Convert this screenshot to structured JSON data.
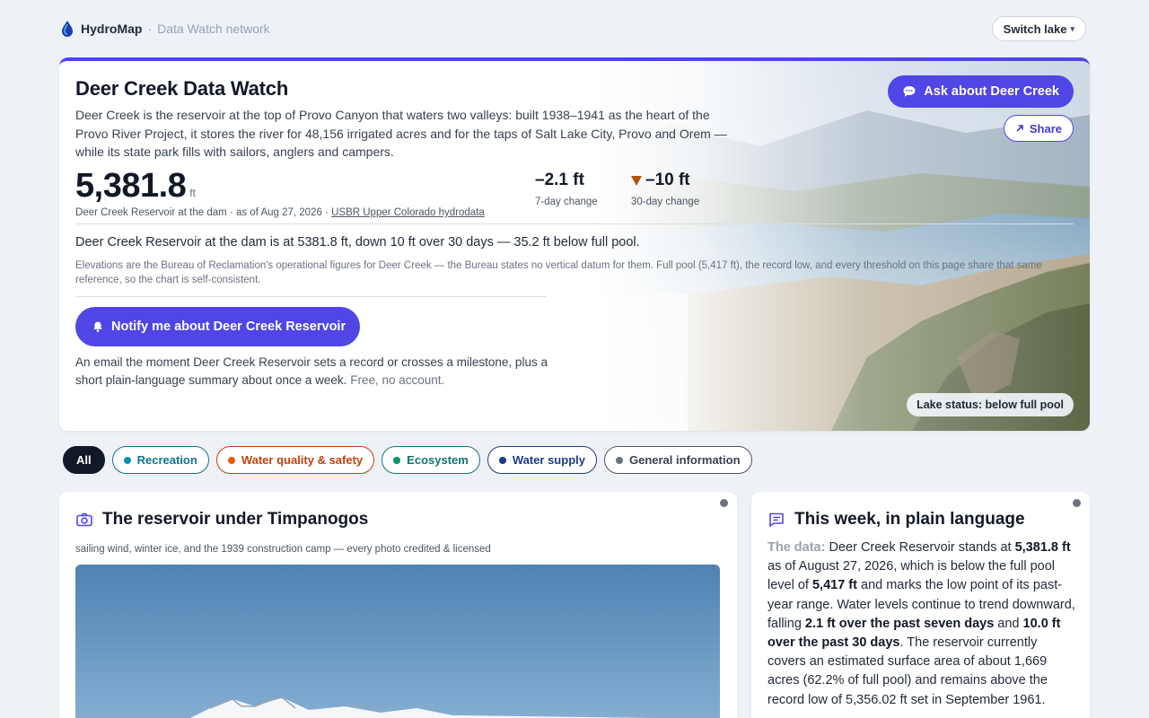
{
  "nav": {
    "brand": "HydroMap",
    "separator": "·",
    "subtitle": "Data Watch network",
    "switch_label": "Switch lake",
    "switch_caret": "▾"
  },
  "hero": {
    "title": "Deer Creek Data Watch",
    "intro": "Deer Creek is the reservoir at the top of Provo Canyon that waters two valleys: built 1938–1941 as the heart of the Provo River Project, it stores the river for 48,156 irrigated acres and for the taps of Salt Lake City, Provo and Orem — while its state park fills with sailors, anglers and campers.",
    "level_value": "5,381.8",
    "level_unit": "ft",
    "level_caption": "Deer Creek Reservoir at the dam · as of Aug 27, 2026 ·",
    "level_source": "USBR Upper Colorado hydrodata",
    "change_7d_value": "–2.1 ft",
    "change_7d_label": "7-day change",
    "change_30d_value": "–10 ft",
    "change_30d_label": "30-day change",
    "summary": "Deer Creek Reservoir at the dam is at 5381.8 ft, down 10 ft over 30 days — 35.2 ft below full pool.",
    "note": "Elevations are the Bureau of Reclamation's operational figures for Deer Creek — the Bureau states no vertical datum for them. Full pool (5,417 ft), the record low, and every threshold on this page share that same reference, so the chart is self-consistent.",
    "notify_label": "Notify me about Deer Creek Reservoir",
    "notify_desc": "An email the moment Deer Creek Reservoir sets a record or crosses a milestone, plus a short plain-language summary about once a week.",
    "notify_free": "Free, no account.",
    "ask_label": "Ask about Deer Creek",
    "share_label": "Share",
    "status_label": "Lake status: below full pool"
  },
  "filters": [
    {
      "label": "All",
      "color": "#111827"
    },
    {
      "label": "Recreation",
      "color": "#0e7490"
    },
    {
      "label": "Water quality & safety",
      "color": "#c2410c"
    },
    {
      "label": "Ecosystem",
      "color": "#0f766e"
    },
    {
      "label": "Water supply",
      "color": "#1e3a8a"
    },
    {
      "label": "General information",
      "color": "#374151"
    }
  ],
  "photo_card": {
    "title": "The reservoir under Timpanogos",
    "subtitle": "sailing wind, winter ice, and the 1939 construction camp — every photo credited & licensed"
  },
  "plain_card": {
    "title": "This week, in plain language",
    "p_label": "The data:",
    "p1": "Deer Creek Reservoir stands at",
    "p_level": "5,381.8 ft",
    "p2": "as of August 27, 2026, which is below the full pool level of",
    "p_full": "5,417 ft",
    "p3": "and marks the low point of its past-year range. Water levels continue to trend downward, falling",
    "p_7d": "2.1 ft over the past seven days",
    "p4": "and",
    "p_30d": "10.0 ft over the past 30 days",
    "p5": ". The reservoir currently covers an estimated surface area of about 1,669 acres (62.2% of full pool) and remains above the record low of 5,356.02 ft set in September 1961."
  },
  "colors": {
    "accent": "#4f46e5",
    "down_arrow": "#b45309"
  }
}
